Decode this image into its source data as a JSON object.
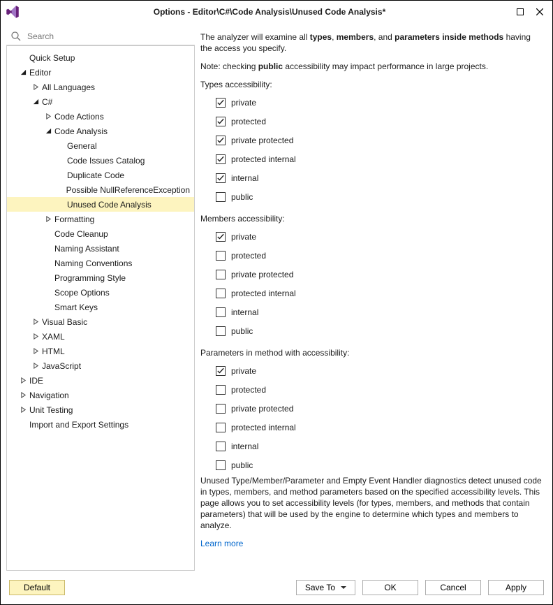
{
  "titlebar": {
    "title": "Options - Editor\\C#\\Code Analysis\\Unused Code Analysis*"
  },
  "search": {
    "placeholder": "Search"
  },
  "tree": [
    {
      "label": "Quick Setup",
      "level": 0,
      "caret": "none"
    },
    {
      "label": "Editor",
      "level": 0,
      "caret": "open"
    },
    {
      "label": "All Languages",
      "level": 1,
      "caret": "closed"
    },
    {
      "label": "C#",
      "level": 1,
      "caret": "open"
    },
    {
      "label": "Code Actions",
      "level": 2,
      "caret": "closed"
    },
    {
      "label": "Code Analysis",
      "level": 2,
      "caret": "open"
    },
    {
      "label": "General",
      "level": 3,
      "caret": "none"
    },
    {
      "label": "Code Issues Catalog",
      "level": 3,
      "caret": "none"
    },
    {
      "label": "Duplicate Code",
      "level": 3,
      "caret": "none"
    },
    {
      "label": "Possible NullReferenceException",
      "level": 3,
      "caret": "none"
    },
    {
      "label": "Unused Code Analysis",
      "level": 3,
      "caret": "none",
      "selected": true
    },
    {
      "label": "Formatting",
      "level": 2,
      "caret": "closed"
    },
    {
      "label": "Code Cleanup",
      "level": 2,
      "caret": "none"
    },
    {
      "label": "Naming Assistant",
      "level": 2,
      "caret": "none"
    },
    {
      "label": "Naming Conventions",
      "level": 2,
      "caret": "none"
    },
    {
      "label": "Programming Style",
      "level": 2,
      "caret": "none"
    },
    {
      "label": "Scope Options",
      "level": 2,
      "caret": "none"
    },
    {
      "label": "Smart Keys",
      "level": 2,
      "caret": "none"
    },
    {
      "label": "Visual Basic",
      "level": 1,
      "caret": "closed"
    },
    {
      "label": "XAML",
      "level": 1,
      "caret": "closed"
    },
    {
      "label": "HTML",
      "level": 1,
      "caret": "closed"
    },
    {
      "label": "JavaScript",
      "level": 1,
      "caret": "closed"
    },
    {
      "label": "IDE",
      "level": 0,
      "caret": "closed"
    },
    {
      "label": "Navigation",
      "level": 0,
      "caret": "closed"
    },
    {
      "label": "Unit Testing",
      "level": 0,
      "caret": "closed"
    },
    {
      "label": "Import and Export Settings",
      "level": 0,
      "caret": "none"
    }
  ],
  "content": {
    "intro_pre": "The analyzer will examine all ",
    "intro_b1": "types",
    "intro_sep1": ", ",
    "intro_b2": "members",
    "intro_sep2": ", and ",
    "intro_b3": "parameters inside methods",
    "intro_post": " having the access you specify.",
    "note_pre": "Note: checking ",
    "note_b": "public",
    "note_post": " accessibility may impact performance in large projects.",
    "sections": [
      {
        "label": "Types accessibility:",
        "items": [
          {
            "label": "private",
            "checked": true
          },
          {
            "label": "protected",
            "checked": true
          },
          {
            "label": "private protected",
            "checked": true
          },
          {
            "label": "protected internal",
            "checked": true
          },
          {
            "label": "internal",
            "checked": true
          },
          {
            "label": "public",
            "checked": false
          }
        ]
      },
      {
        "label": "Members accessibility:",
        "items": [
          {
            "label": "private",
            "checked": true
          },
          {
            "label": "protected",
            "checked": false
          },
          {
            "label": "private protected",
            "checked": false
          },
          {
            "label": "protected internal",
            "checked": false
          },
          {
            "label": "internal",
            "checked": false
          },
          {
            "label": "public",
            "checked": false
          }
        ]
      },
      {
        "label": "Parameters in method with accessibility:",
        "items": [
          {
            "label": "private",
            "checked": true
          },
          {
            "label": "protected",
            "checked": false
          },
          {
            "label": "private protected",
            "checked": false
          },
          {
            "label": "protected internal",
            "checked": false
          },
          {
            "label": "internal",
            "checked": false
          },
          {
            "label": "public",
            "checked": false
          }
        ]
      }
    ],
    "footer": "Unused Type/Member/Parameter and Empty Event Handler diagnostics detect unused code in types, members, and method parameters based on the specified accessibility levels. This page allows you to set accessibility levels (for types, members, and methods that contain parameters) that will be used by the engine to determine which types and members to analyze.",
    "learn_more": "Learn more"
  },
  "buttons": {
    "default": "Default",
    "save_to": "Save To",
    "ok": "OK",
    "cancel": "Cancel",
    "apply": "Apply"
  }
}
